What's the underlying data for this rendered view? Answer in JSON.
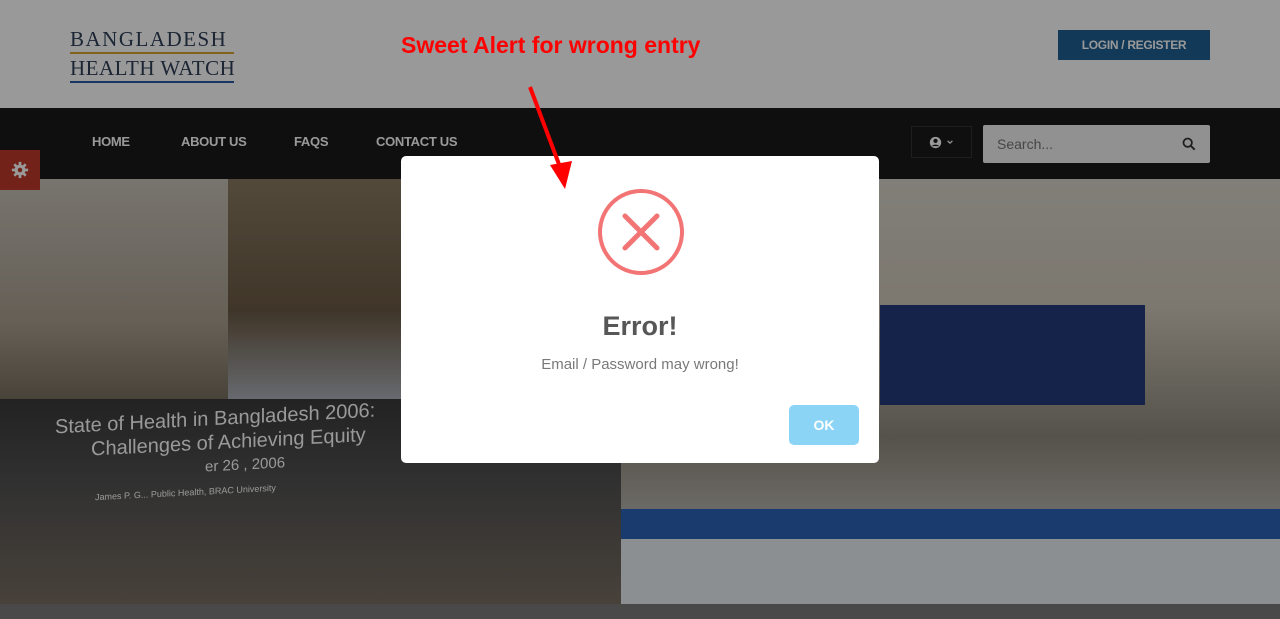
{
  "header": {
    "logo_line1": "BANGLADESH",
    "logo_line2": "HEALTH WATCH",
    "login_label": "LOGIN / REGISTER"
  },
  "annotation": {
    "text": "Sweet Alert for wrong entry",
    "color": "#ff0000"
  },
  "nav": {
    "items": [
      {
        "label": "HOME"
      },
      {
        "label": "ABOUT US"
      },
      {
        "label": "FAQS"
      },
      {
        "label": "CONTACT US"
      }
    ],
    "user_menu_icon": "user-circle-icon",
    "search": {
      "placeholder": "Search...",
      "icon": "search-icon"
    }
  },
  "hero": {
    "banner_line1": "State of Health in Bangladesh 2006:",
    "banner_line2": "Challenges of Achieving Equity",
    "banner_line3": "er 26 , 2006",
    "banner_line4": "James P. G... Public Health, BRAC University"
  },
  "alert": {
    "icon": "error-x-icon",
    "title": "Error!",
    "message": "Email / Password may wrong!",
    "ok_label": "OK",
    "error_color": "#f27474",
    "ok_color": "#8cd4f5"
  },
  "settings_icon": "gear-icon"
}
